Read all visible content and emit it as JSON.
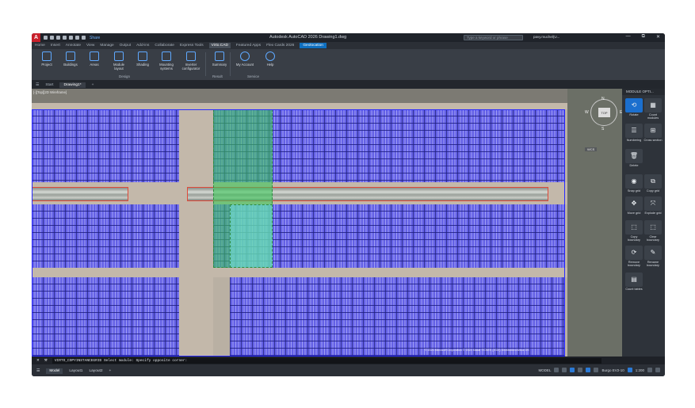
{
  "app": {
    "logo": "A",
    "title": "Autodesk AutoCAD 2026   Drawing1.dwg",
    "share": "Share",
    "search_placeholder": "Type a keyword or phrase",
    "user": "pavy.muchel(U...",
    "window_controls": [
      "—",
      "⧉",
      "✕"
    ]
  },
  "ribbon_tabs": [
    "Home",
    "Insert",
    "Annotate",
    "View",
    "Manage",
    "Output",
    "Add-ins",
    "Collaborate",
    "Express Tools",
    "Virto.CAD",
    "Featured Apps",
    "Flex Cards 2026",
    "Geolocation"
  ],
  "active_tab": "Virto.CAD",
  "highlight_tab": "Geolocation",
  "ribbon": {
    "buttons": [
      {
        "label": "Project",
        "icon": "project-icon"
      },
      {
        "label": "Buildings",
        "icon": "buildings-icon"
      },
      {
        "label": "Areas",
        "icon": "areas-icon"
      },
      {
        "label": "Module layout",
        "icon": "module-layout-icon"
      },
      {
        "label": "Shading",
        "icon": "shading-icon"
      },
      {
        "label": "Mounting systems",
        "icon": "mounting-icon"
      },
      {
        "label": "Inverter configurator",
        "icon": "inverter-icon"
      },
      {
        "label": "Summary",
        "icon": "summary-icon"
      },
      {
        "label": "My Account",
        "icon": "account-icon"
      },
      {
        "label": "Help",
        "icon": "help-icon"
      }
    ],
    "panels": [
      "Design",
      "Result",
      "Service"
    ]
  },
  "file_tabs": {
    "start": "Start",
    "current": "Drawing1*"
  },
  "viewport": {
    "label": "[-][Top][2D Wireframe]",
    "compass": {
      "n": "N",
      "e": "E",
      "s": "S",
      "w": "W"
    },
    "viewcube_top": "TOP",
    "wcs": "WCS",
    "copyright": "© 2024 Microsoft Corporation © 2024 Maxar ©CNES (2024) Distribution Airbus DS"
  },
  "right_panel": {
    "title": "MODULE OPTI...",
    "tools": [
      {
        "label": "Rotate",
        "icon": "rotate-icon"
      },
      {
        "label": "Count modules",
        "icon": "count-icon"
      },
      {
        "label": "Numbering",
        "icon": "numbering-icon"
      },
      {
        "label": "Cross section",
        "icon": "cross-section-icon"
      },
      {
        "label": "Delete",
        "icon": "trash-icon"
      },
      {
        "label": "Snap grid",
        "icon": "toggle-icon"
      },
      {
        "label": "Copy grid",
        "icon": "copy-icon"
      },
      {
        "label": "Move grid",
        "icon": "move-icon"
      },
      {
        "label": "Explode grid",
        "icon": "explode-icon"
      },
      {
        "label": "Copy boundary",
        "icon": "copy-boundary-icon"
      },
      {
        "label": "Clear boundary",
        "icon": "clear-boundary-icon"
      },
      {
        "label": "Remove boundary",
        "icon": "remove-boundary-icon"
      },
      {
        "label": "Rename boundary",
        "icon": "pencil-icon"
      },
      {
        "label": "Count tables",
        "icon": "tables-icon"
      }
    ]
  },
  "command": {
    "text": "VIRTO_COPYINSTANCEGRID Select module: Specify opposite corner:"
  },
  "status": {
    "layouts": [
      "Model",
      "Layout1",
      "Layout2"
    ],
    "active_layout": "Model",
    "model": "MODEL",
    "scale": "1:200",
    "coords": "Burgo EV2-10"
  },
  "colors": {
    "accent": "#1b6fce",
    "module": "#6461e6",
    "selection": "#3cc85a"
  }
}
